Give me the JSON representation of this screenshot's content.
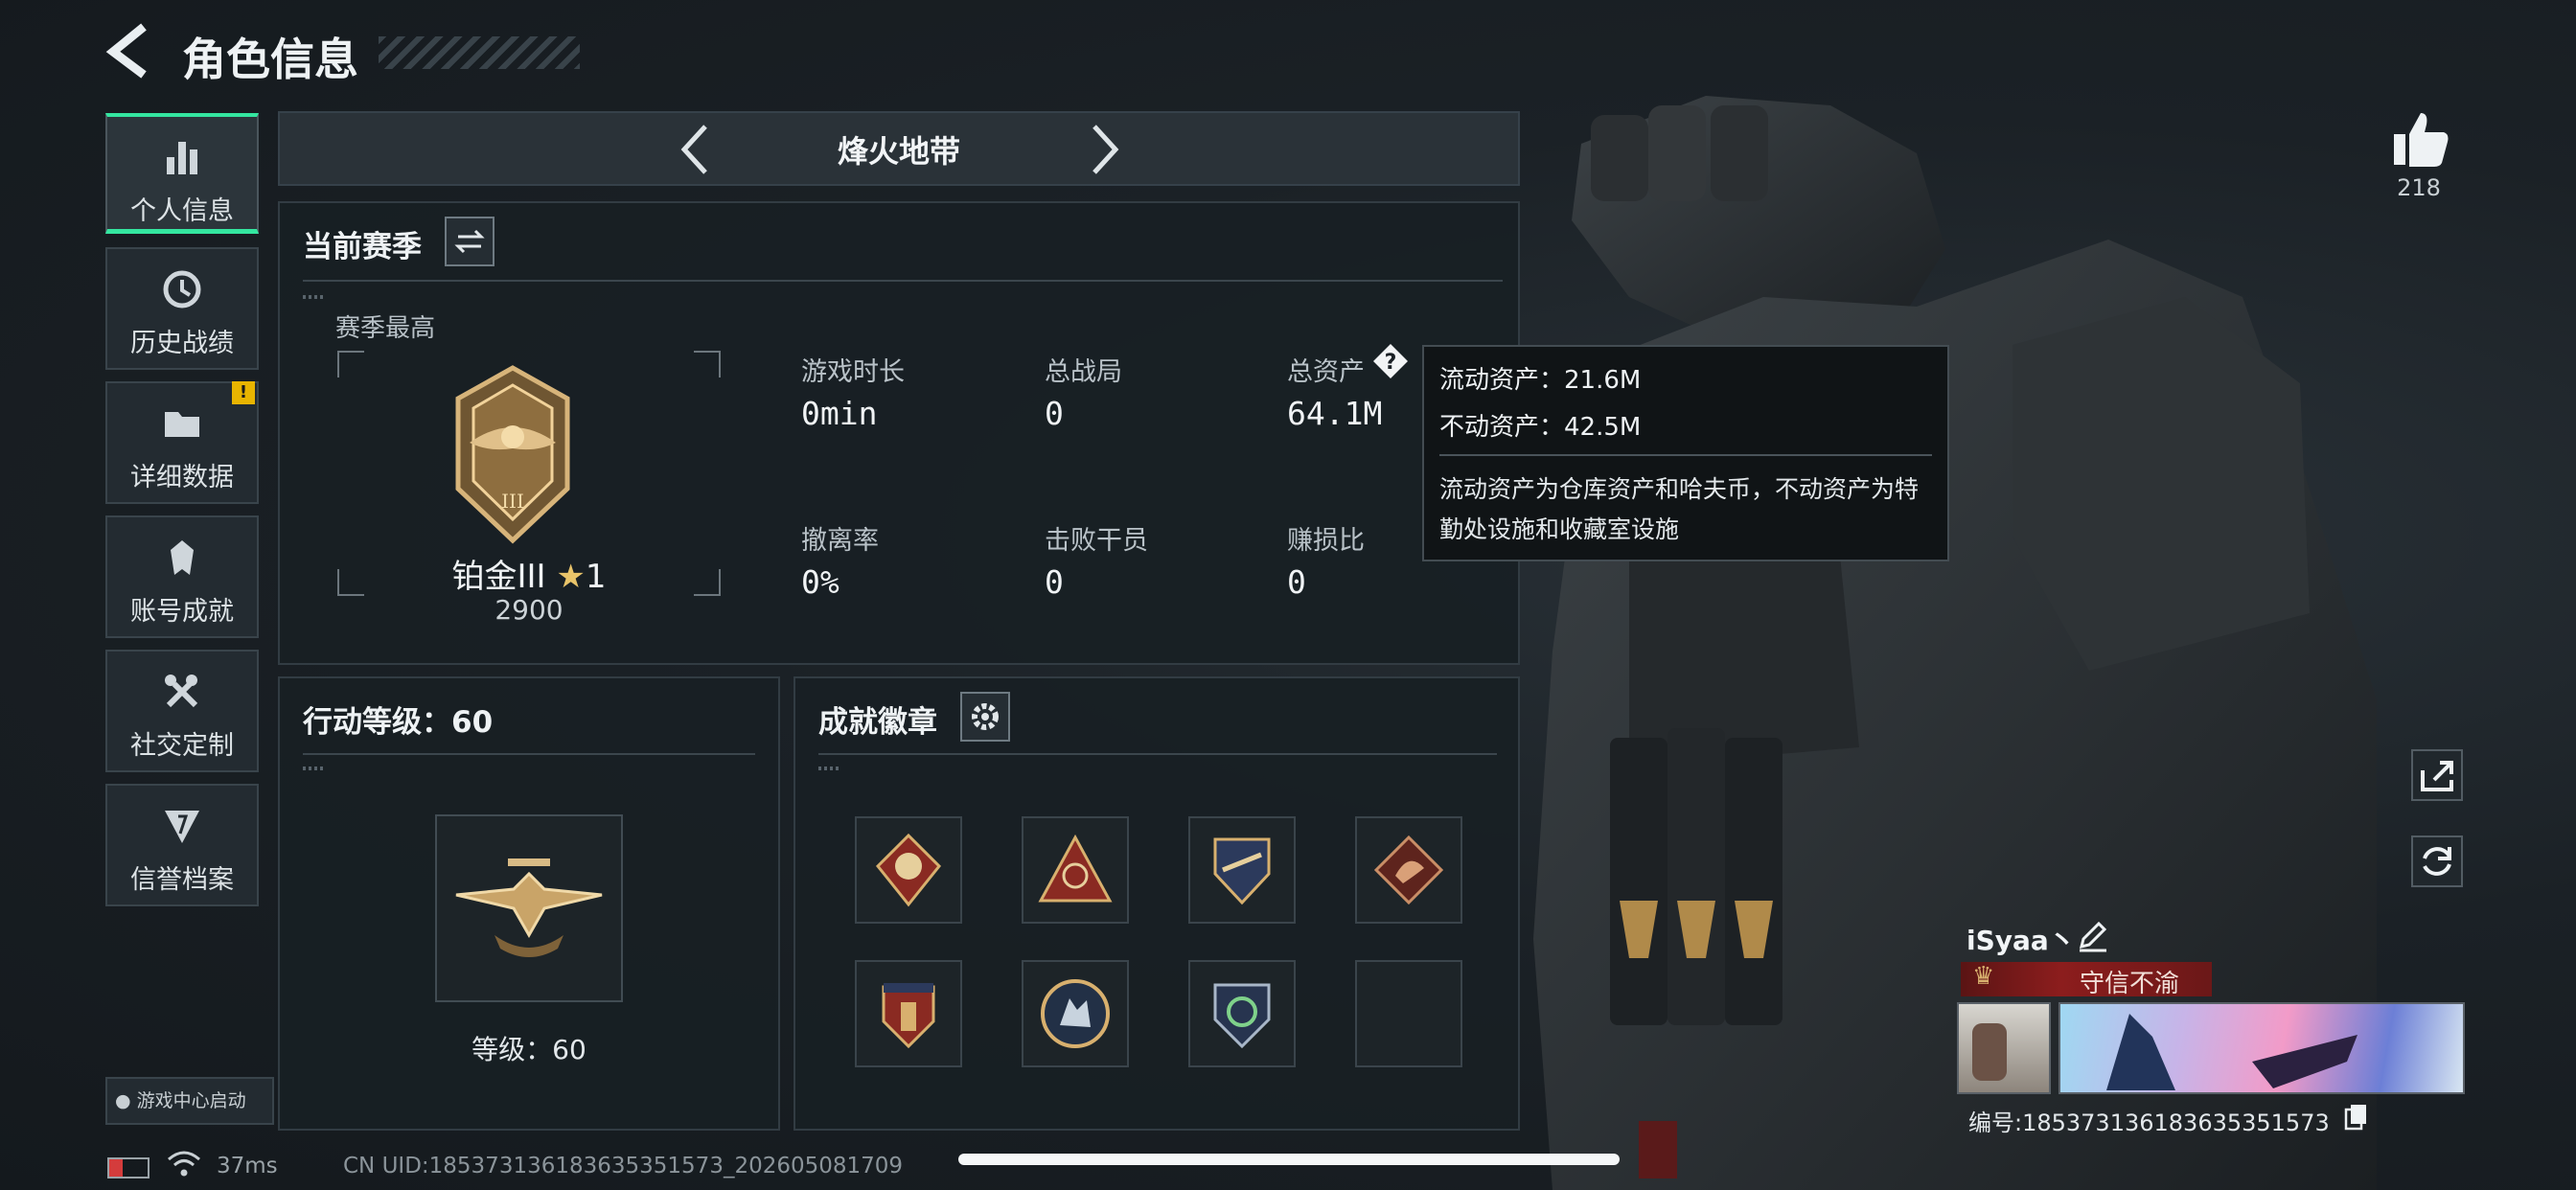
{
  "header": {
    "title": "角色信息"
  },
  "sidebar": {
    "items": [
      {
        "label": "个人信息",
        "icon": "bar-chart-icon",
        "active": true
      },
      {
        "label": "历史战绩",
        "icon": "history-icon"
      },
      {
        "label": "详细数据",
        "icon": "folder-icon",
        "badge": "!"
      },
      {
        "label": "账号成就",
        "icon": "achievement-icon"
      },
      {
        "label": "社交定制",
        "icon": "tools-icon"
      },
      {
        "label": "信誉档案",
        "icon": "reputation-icon"
      }
    ],
    "launch_label": "游戏中心启动"
  },
  "mode_selector": {
    "title": "烽火地带"
  },
  "season": {
    "title": "当前赛季",
    "best_label": "赛季最高",
    "rank_name": "铂金III",
    "rank_stars": "1",
    "rank_points": "2900",
    "stats": [
      {
        "label": "游戏时长",
        "value": "0min"
      },
      {
        "label": "总战局",
        "value": "0"
      },
      {
        "label": "总资产",
        "value": "64.1M"
      },
      {
        "label": "撤离率",
        "value": "0%"
      },
      {
        "label": "击败干员",
        "value": "0"
      },
      {
        "label": "赚损比",
        "value": "0"
      }
    ]
  },
  "tooltip": {
    "line1": "流动资产：21.6M",
    "line2": "不动资产：42.5M",
    "desc": "流动资产为仓库资产和哈夫币，不动资产为特勤处设施和收藏室设施"
  },
  "action_level": {
    "title": "行动等级：60",
    "level_label": "等级：60"
  },
  "badges": {
    "title": "成就徽章",
    "count_filled": 7,
    "slot_count": 8
  },
  "likes": {
    "count": "218"
  },
  "profile": {
    "name": "iSyaa丶",
    "title_badge": "守信不渝",
    "id_line": "编号:18537313618363535157​3"
  },
  "status_bar": {
    "ping": "37ms",
    "uid": "CN UID:18537313618363535157​3_202605081709"
  },
  "colors": {
    "accent": "#34e6a0",
    "warning": "#e8b400",
    "title_red": "#8c1d1d"
  }
}
